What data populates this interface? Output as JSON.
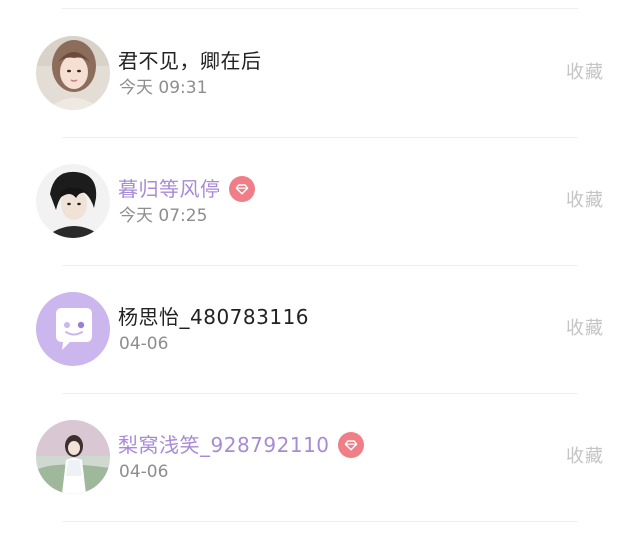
{
  "collect_label": "收藏",
  "colors": {
    "vip_name": "#a98ad6",
    "vip_badge": "#f07e86",
    "time_text": "#8e8e8e",
    "action_text": "#c4c4c4",
    "default_avatar": "#cbb6ee"
  },
  "conversations": [
    {
      "name": "君不见，卿在后",
      "time": "今天 09:31",
      "vip": false,
      "avatar_icon": "photo-avatar-girl-icon"
    },
    {
      "name": "暮归等风停",
      "time": "今天 07:25",
      "vip": true,
      "avatar_icon": "photo-avatar-boy-icon"
    },
    {
      "name": "杨思怡_480783116",
      "time": "04-06",
      "vip": false,
      "avatar_icon": "default-chat-bubble-avatar-icon"
    },
    {
      "name": "梨窝浅笑_928792110",
      "time": "04-06",
      "vip": true,
      "avatar_icon": "photo-avatar-girl-outdoor-icon"
    }
  ]
}
